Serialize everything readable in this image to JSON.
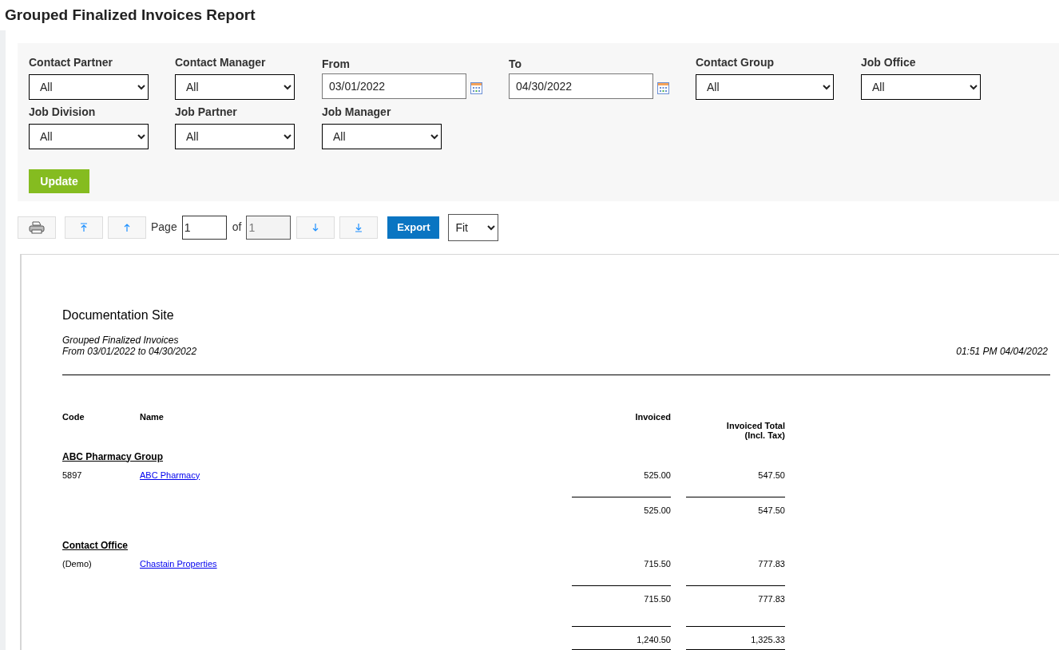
{
  "page_title": "Grouped Finalized Invoices Report",
  "filters": [
    {
      "label": "Contact Partner",
      "kind": "select",
      "value": "All"
    },
    {
      "label": "Contact Manager",
      "kind": "select",
      "value": "All"
    },
    {
      "label": "From",
      "kind": "date",
      "value": "03/01/2022"
    },
    {
      "label": "To",
      "kind": "date",
      "value": "04/30/2022"
    },
    {
      "label": "Contact Group",
      "kind": "select",
      "value": "All"
    },
    {
      "label": "Job Office",
      "kind": "select",
      "value": "All"
    },
    {
      "label": "Job Division",
      "kind": "select",
      "value": "All"
    },
    {
      "label": "Job Partner",
      "kind": "select",
      "value": "All"
    },
    {
      "label": "Job Manager",
      "kind": "select",
      "value": "All"
    }
  ],
  "update_button": "Update",
  "toolbar": {
    "page_label": "Page",
    "page": "1",
    "of_label": "of",
    "page_count": "1",
    "export_button": "Export",
    "zoom": "Fit"
  },
  "report": {
    "site": "Documentation Site",
    "title": "Grouped Finalized Invoices",
    "range": "From 03/01/2022 to 04/30/2022",
    "printed": "01:51 PM 04/04/2022",
    "columns": [
      "Code",
      "Name",
      "Invoiced",
      "Invoiced Total\n(Incl. Tax)"
    ],
    "groups": [
      {
        "name": "ABC Pharmacy Group",
        "rows": [
          {
            "code": "5897",
            "name": "ABC Pharmacy",
            "invoiced": "525.00",
            "total": "547.50"
          }
        ],
        "subtotal": {
          "invoiced": "525.00",
          "total": "547.50"
        }
      },
      {
        "name": "Contact Office",
        "rows": [
          {
            "code": "(Demo)",
            "name": "Chastain Properties",
            "invoiced": "715.50",
            "total": "777.83"
          }
        ],
        "subtotal": {
          "invoiced": "715.50",
          "total": "777.83"
        }
      }
    ],
    "grand_total": {
      "invoiced": "1,240.50",
      "total": "1,325.33"
    }
  }
}
